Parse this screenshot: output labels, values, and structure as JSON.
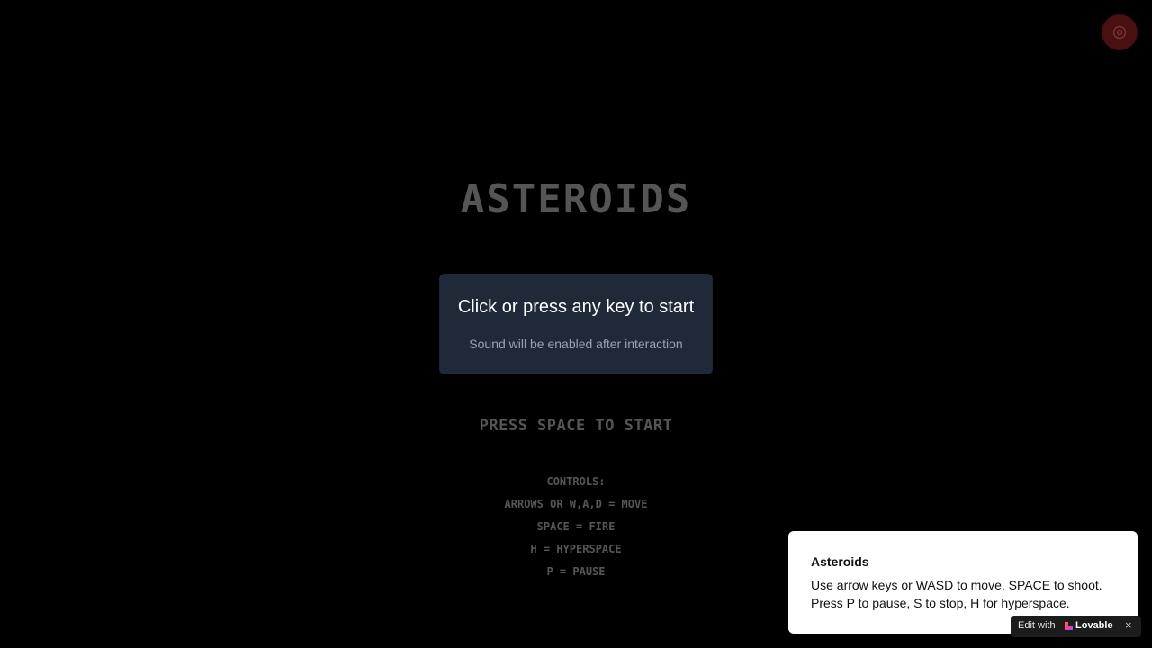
{
  "game": {
    "title": "ASTEROIDS",
    "start_prompt": "PRESS SPACE TO START",
    "controls_heading": "CONTROLS:",
    "controls": [
      "ARROWS OR W,A,D = MOVE",
      "SPACE = FIRE",
      "H = HYPERSPACE",
      "P = PAUSE"
    ]
  },
  "start_card": {
    "heading": "Click or press any key to start",
    "subtext": "Sound will be enabled after interaction"
  },
  "sound_button": {
    "icon": "target-icon",
    "color": "#4a1010"
  },
  "toast": {
    "title": "Asteroids",
    "description": "Use arrow keys or WASD to move, SPACE to shoot. Press P to pause, S to stop, H for hyperspace."
  },
  "lovable_badge": {
    "prefix": "Edit with",
    "brand": "Lovable",
    "close_glyph": "×"
  },
  "colors": {
    "background": "#000000",
    "card": "#1f2937",
    "dim_text": "#555555"
  }
}
